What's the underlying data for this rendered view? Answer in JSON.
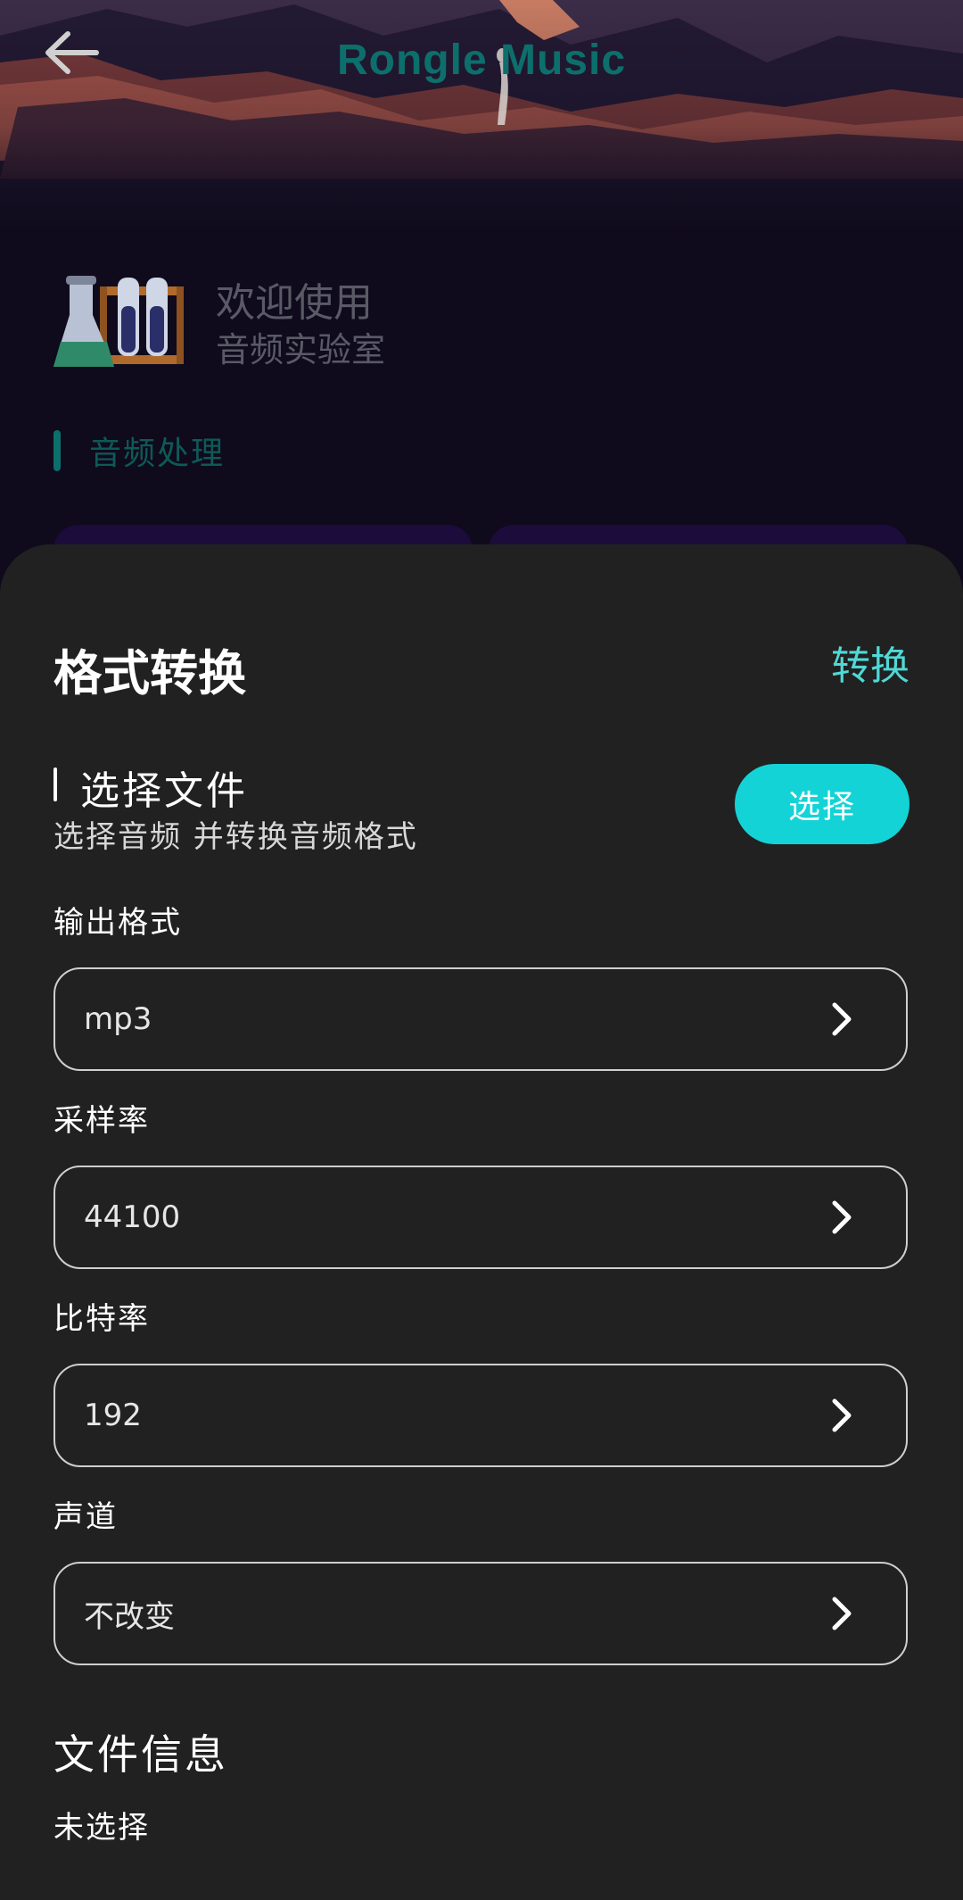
{
  "header": {
    "title": "Rongle Music",
    "back_icon": "arrow-left-icon"
  },
  "welcome": {
    "line1": "欢迎使用",
    "line2": "音频实验室",
    "icon": "lab-flask-icon"
  },
  "section": {
    "label": "音频处理"
  },
  "sheet": {
    "title": "格式转换",
    "action_label": "转换",
    "file_select": {
      "title": "选择文件",
      "description": "选择音频 并转换音频格式",
      "button_label": "选择"
    },
    "fields": [
      {
        "label": "输出格式",
        "value": "mp3"
      },
      {
        "label": "采样率",
        "value": "44100"
      },
      {
        "label": "比特率",
        "value": "192"
      },
      {
        "label": "声道",
        "value": "不改变"
      }
    ],
    "file_info": {
      "title": "文件信息",
      "value": "未选择"
    }
  },
  "colors": {
    "accent": "#14d3d6",
    "accent_text": "#4fd9d6",
    "sheet_bg": "#212121",
    "page_bg": "#0f0a1c",
    "brand_teal": "#0d6f6c"
  }
}
